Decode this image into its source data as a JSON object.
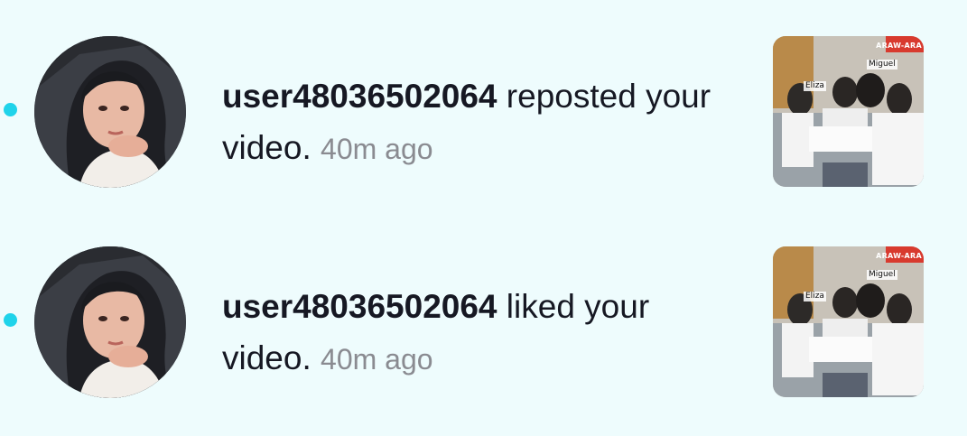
{
  "notifications": [
    {
      "username": "user48036502064",
      "action_text": " reposted your video.",
      "time": "40m ago",
      "unread": true,
      "avatar_icon": "user-avatar-photo",
      "thumbnail": {
        "banner": "ARAW-ARA",
        "tags": [
          "Eliza",
          "Miguel"
        ]
      }
    },
    {
      "username": "user48036502064",
      "action_text": " liked your video.",
      "time": "40m ago",
      "unread": true,
      "avatar_icon": "user-avatar-photo",
      "thumbnail": {
        "banner": "ARAW-ARA",
        "tags": [
          "Eliza",
          "Miguel"
        ]
      }
    }
  ],
  "colors": {
    "background": "#eefcfd",
    "unread_dot": "#1fd3ea",
    "text": "#161823",
    "muted": "#8a8b91"
  }
}
